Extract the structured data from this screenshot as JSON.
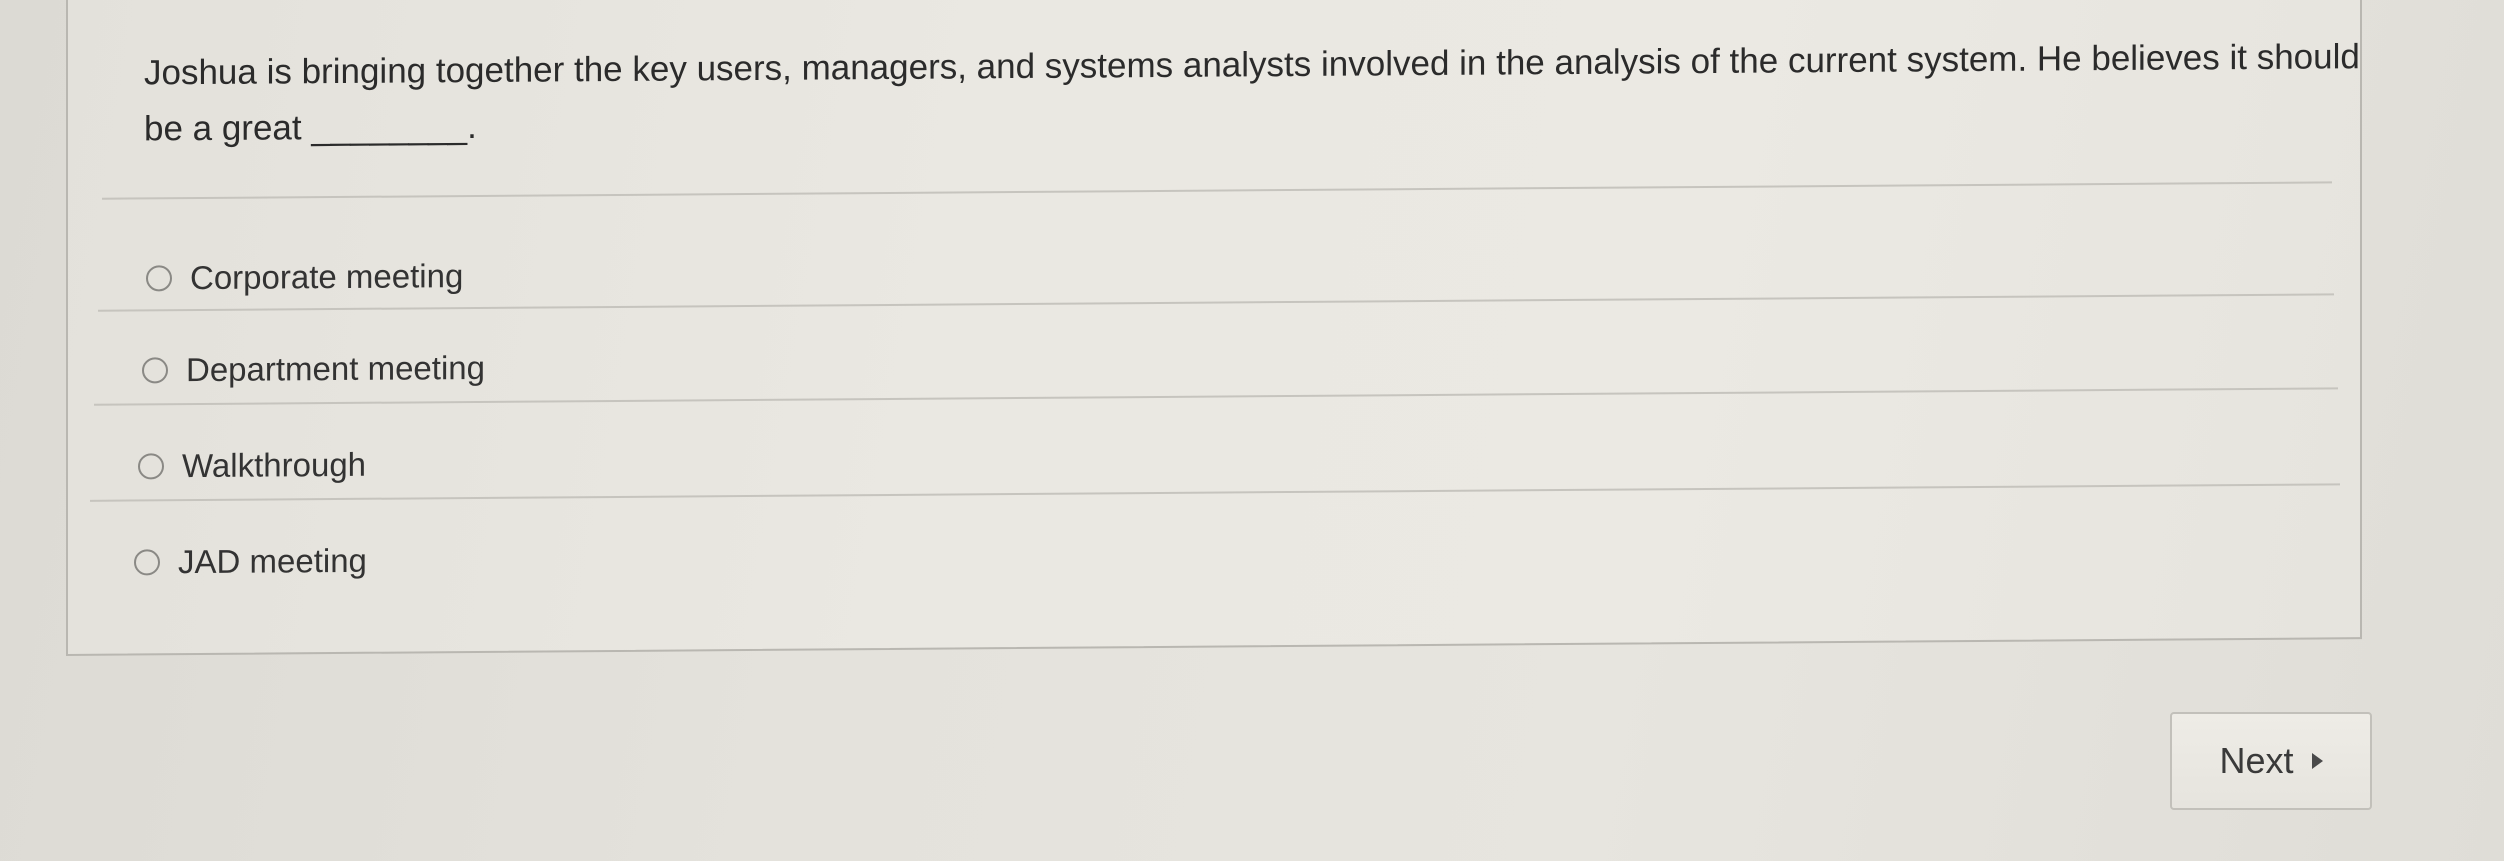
{
  "question": {
    "text": "Joshua is bringing together the key users, managers, and systems analysts involved in the analysis of the current system. He believes it should be a great ________."
  },
  "options": [
    {
      "label": "Corporate meeting",
      "selected": false
    },
    {
      "label": "Department meeting",
      "selected": false
    },
    {
      "label": "Walkthrough",
      "selected": false
    },
    {
      "label": "JAD meeting",
      "selected": false
    }
  ],
  "navigation": {
    "next_label": "Next",
    "next_icon": "triangle-right-icon"
  }
}
